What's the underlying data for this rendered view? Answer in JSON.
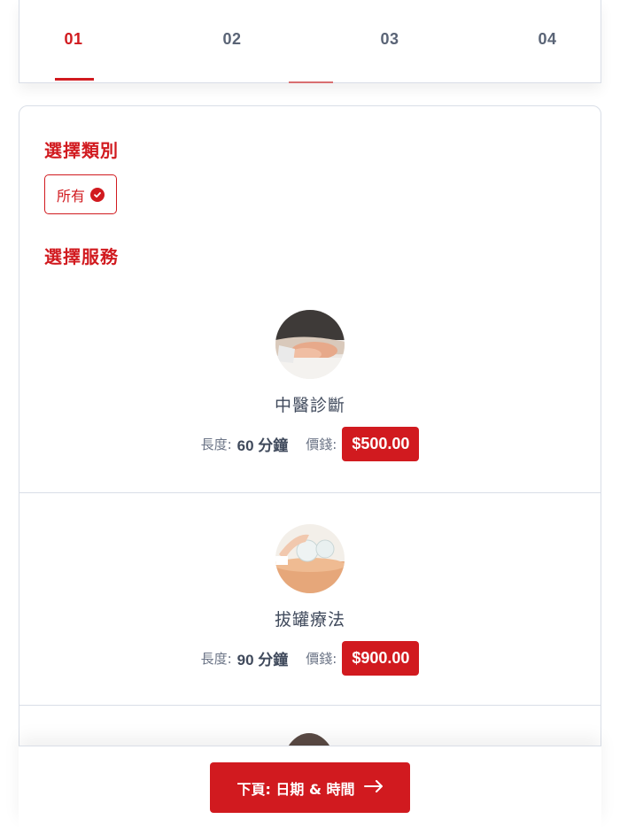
{
  "steps": [
    {
      "label": "01",
      "active": true
    },
    {
      "label": "02",
      "active": false
    },
    {
      "label": "03",
      "active": false
    },
    {
      "label": "04",
      "active": false
    }
  ],
  "category": {
    "title": "選擇類別",
    "chip_label": "所有",
    "chip_icon": "check-circle-icon"
  },
  "services_section": {
    "title": "選擇服務",
    "items": [
      {
        "name": "中醫診斷",
        "duration_label": "長度:",
        "duration_value": "60 分鐘",
        "price_label": "價錢:",
        "price": "$500.00"
      },
      {
        "name": "拔罐療法",
        "duration_label": "長度:",
        "duration_value": "90 分鐘",
        "price_label": "價錢:",
        "price": "$900.00"
      }
    ]
  },
  "footer": {
    "next_label": "下頁: 日期 & 時間",
    "next_icon": "arrow-right-icon"
  },
  "colors": {
    "accent": "#d11a1f",
    "border": "#d9dee7",
    "text": "#404a5c"
  }
}
